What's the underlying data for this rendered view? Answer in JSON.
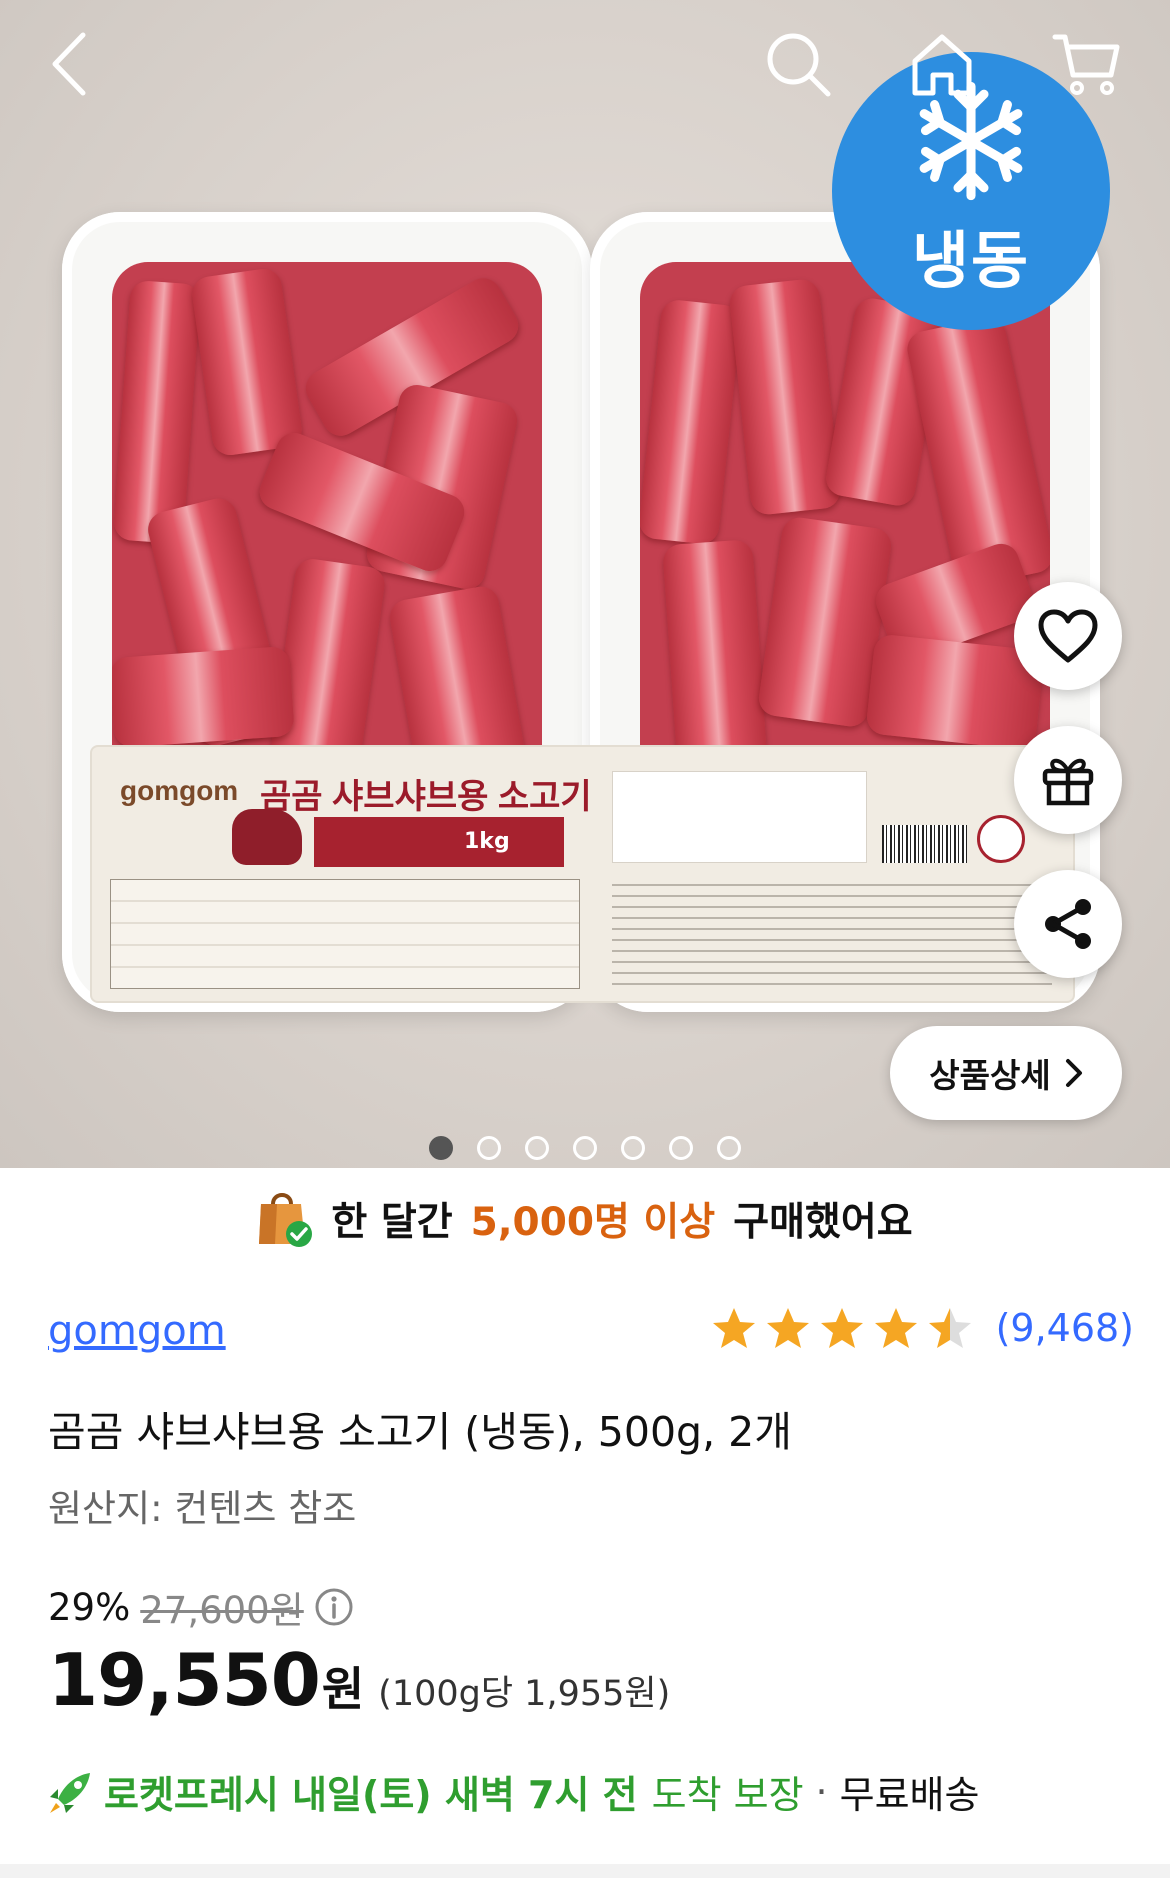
{
  "hero": {
    "badge_text": "냉동",
    "detail_button_label": "상품상세",
    "page_dots_total": 7,
    "page_dots_active": 1,
    "package": {
      "brand": "gomgom",
      "title": "곰곰 샤브샤브용 소고기",
      "weight": "1kg"
    }
  },
  "icons": {
    "back": "chevron-left-icon",
    "search": "search-icon",
    "home": "home-icon",
    "cart": "cart-icon",
    "wishlist": "heart-icon",
    "gift": "gift-icon",
    "share": "share-icon"
  },
  "buyers": {
    "prefix": "한 달간",
    "highlight": "5,000명 이상",
    "suffix": "구매했어요"
  },
  "product": {
    "brand": "gomgom",
    "rating": 4.5,
    "rating_max": 5,
    "review_count": "(9,468)",
    "title": "곰곰 샤브샤브용 소고기 (냉동), 500g, 2개",
    "origin": "원산지: 컨텐츠 참조"
  },
  "price": {
    "discount_rate": "29%",
    "original_price": "27,600원",
    "sale_price": "19,550",
    "currency": "원",
    "unit_price": "(100g당 1,955원)"
  },
  "delivery": {
    "rocket_text": "로켓프레시 내일(토) 새벽 7시 전",
    "guarantee": "도착 보장",
    "separator": "·",
    "shipping": "무료배송"
  },
  "colors": {
    "accent_blue": "#346aff",
    "highlight_orange": "#d9620f",
    "rocket_green": "#2f9e2f",
    "badge_blue": "#2d8ee0",
    "star_yellow": "#f5a623"
  }
}
